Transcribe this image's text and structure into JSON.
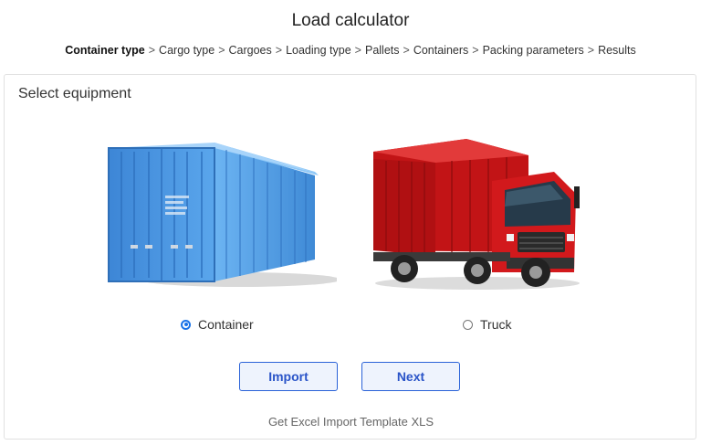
{
  "page": {
    "title": "Load calculator"
  },
  "breadcrumb": {
    "separator": ">",
    "items": [
      {
        "label": "Container type",
        "active": true
      },
      {
        "label": "Cargo type",
        "active": false
      },
      {
        "label": "Cargoes",
        "active": false
      },
      {
        "label": "Loading type",
        "active": false
      },
      {
        "label": "Pallets",
        "active": false
      },
      {
        "label": "Containers",
        "active": false
      },
      {
        "label": "Packing parameters",
        "active": false
      },
      {
        "label": "Results",
        "active": false
      }
    ]
  },
  "panel": {
    "title": "Select equipment",
    "options": [
      {
        "label": "Container",
        "selected": true,
        "image": "blue-shipping-container-image"
      },
      {
        "label": "Truck",
        "selected": false,
        "image": "red-box-truck-image"
      }
    ],
    "buttons": {
      "import_label": "Import",
      "next_label": "Next"
    },
    "template_link": "Get Excel Import Template XLS"
  },
  "colors": {
    "accent": "#2a62d8",
    "container_blue": "#4a96e0",
    "truck_red": "#d2191c"
  }
}
